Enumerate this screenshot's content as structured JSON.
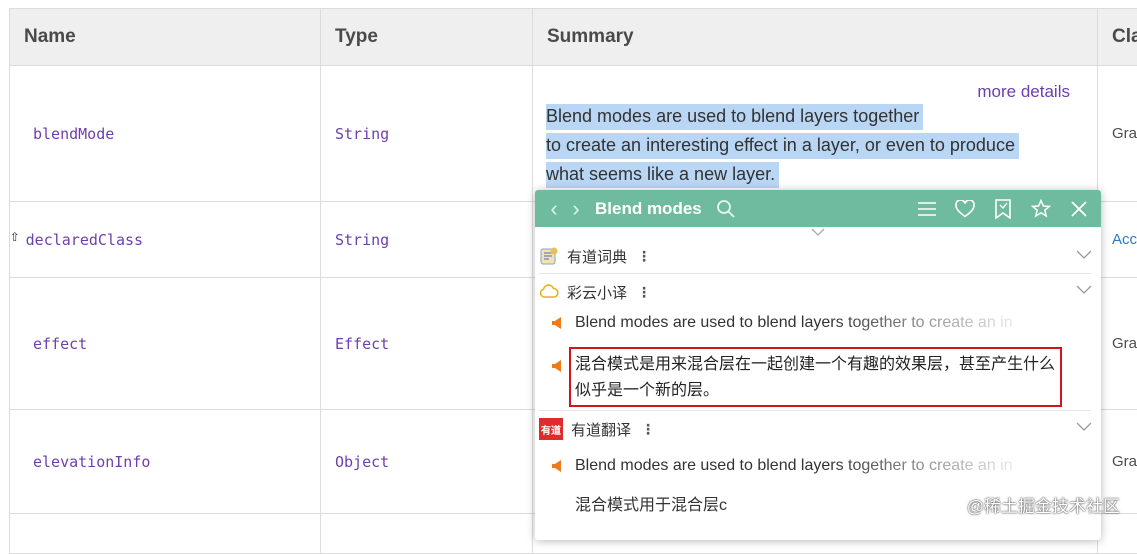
{
  "table": {
    "headers": [
      "Name",
      "Type",
      "Summary",
      "Cla"
    ],
    "rows": [
      {
        "name": "blendMode",
        "type": "String",
        "cls": "Gra",
        "cls_link": false,
        "inherited": false
      },
      {
        "name": "declaredClass",
        "type": "String",
        "cls": "Acc",
        "cls_link": true,
        "inherited": true
      },
      {
        "name": "effect",
        "type": "Effect",
        "cls": "Gra",
        "cls_link": false,
        "inherited": false
      },
      {
        "name": "elevationInfo",
        "type": "Object",
        "cls": "Gra",
        "cls_link": false,
        "inherited": false
      }
    ],
    "inherited_icon": "up-arrow-icon",
    "more_details": "more details",
    "summary_lines": [
      "Blend modes are used to blend layers together",
      "to create an interesting effect in a layer, or even to produce",
      "what seems like a new layer."
    ]
  },
  "popup": {
    "title": "Blend modes",
    "accent_color": "#6fbb9f",
    "sections": {
      "dict": {
        "title": "有道词典"
      },
      "caiyun": {
        "title": "彩云小译",
        "source": "Blend modes are used to blend layers together to create an in",
        "translation": "混合模式是用来混合层在一起创建一个有趣的效果层，甚至产生什么似乎是一个新的层。"
      },
      "youdao": {
        "title": "有道翻译",
        "logo_text": "有道",
        "source": "Blend modes are used to blend layers together to create an in",
        "translation": "混合模式用于混合层c"
      }
    }
  },
  "watermark": "@稀土掘金技术社区"
}
